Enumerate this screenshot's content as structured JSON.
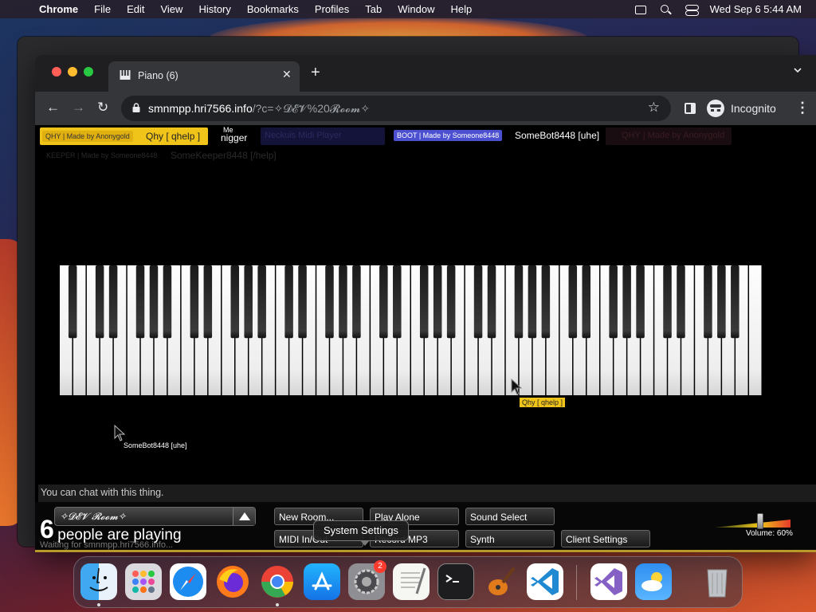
{
  "menubar": {
    "app": "Chrome",
    "items": [
      "File",
      "Edit",
      "View",
      "History",
      "Bookmarks",
      "Profiles",
      "Tab",
      "Window",
      "Help"
    ],
    "datetime": "Wed Sep 6  5:44 AM"
  },
  "browser": {
    "tab_title": "Piano (6)",
    "url_host": "smnmpp.hri7566.info",
    "url_path": "/?c=✧𝓓𝓔𝓥%20𝓡𝓸𝓸𝓶✧",
    "incognito_label": "Incognito"
  },
  "players": {
    "qhy_tag": "QHY | Made by Anonygold",
    "qhy_name": "Qhy [ qhelp ]",
    "me_label": "Me",
    "me_name": "nigger",
    "faded1": "Neckuis Midi Player",
    "boot_tag": "BOOT | Made by Someone8448",
    "boot_name": "SomeBot8448 [uhe]",
    "faded2": "QHY | Made by Anonygold",
    "keeper_tag": "KEEPER | Made by Someone8448",
    "keeper_name": "SomeKeeper8448 [/help]"
  },
  "cursors": {
    "qhy_label": "Qhy [ qhelp ]",
    "bot_label": "SomeBot8448 [uhe]"
  },
  "chat": {
    "placeholder": "You can chat with this thing."
  },
  "controls": {
    "room_name": "✧𝓓𝓔𝓥 𝓡𝓸𝓸𝓶✧",
    "people_count": "6",
    "people_label": "people are playing",
    "waiting": "Waiting for smnmpp.hri7566.info...",
    "new_room": "New Room...",
    "play_alone": "Play Alone",
    "sound_select": "Sound Select",
    "midi_inout": "MIDI In/Out",
    "record_mp3": "Record MP3",
    "synth": "Synth",
    "client_settings": "Client Settings",
    "volume": "Volume: 60%",
    "volume_level": 0.6
  },
  "tooltip": "System Settings",
  "dock": {
    "apps": [
      "finder-icon",
      "launchpad-icon",
      "safari-icon",
      "firefox-icon",
      "chrome-icon",
      "app-store-icon",
      "system-settings-icon",
      "textedit-icon",
      "terminal-icon",
      "garageband-icon",
      "vscode-icon",
      "visual-studio-icon",
      "weather-icon",
      "trash-icon"
    ],
    "settings_badge": "2"
  },
  "colors": {
    "qhy_tag_bg": "#e8c81e",
    "boot_tag_bg": "#5a5ad8",
    "accent_yellow": "#f0c419"
  }
}
